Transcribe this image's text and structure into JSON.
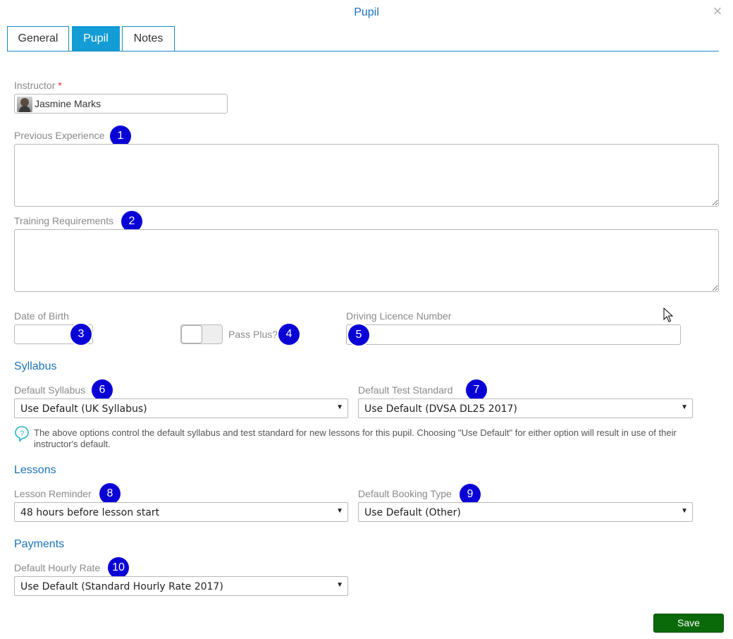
{
  "dialog": {
    "title": "Pupil",
    "close_icon": "×"
  },
  "tabs": [
    {
      "label": "General",
      "active": false
    },
    {
      "label": "Pupil",
      "active": true
    },
    {
      "label": "Notes",
      "active": false
    }
  ],
  "form": {
    "instructor": {
      "label": "Instructor",
      "required_mark": "*",
      "value": "Jasmine Marks"
    },
    "previous_experience": {
      "label": "Previous Experience",
      "value": ""
    },
    "training_requirements": {
      "label": "Training Requirements",
      "value": ""
    },
    "date_of_birth": {
      "label": "Date of Birth",
      "value": ""
    },
    "pass_plus": {
      "label": "Pass Plus?",
      "checked": false
    },
    "driving_licence": {
      "label": "Driving Licence Number",
      "value": ""
    }
  },
  "sections": {
    "syllabus": "Syllabus",
    "lessons": "Lessons",
    "payments": "Payments"
  },
  "syllabus": {
    "default_syllabus": {
      "label": "Default Syllabus",
      "value": "Use Default (UK Syllabus)"
    },
    "default_test_standard": {
      "label": "Default Test Standard",
      "value": "Use Default (DVSA DL25 2017)"
    },
    "help_text": "The above options control the default syllabus and test standard for new lessons for this pupil. Choosing \"Use Default\" for either option will result in use of their instructor's default."
  },
  "lessons": {
    "lesson_reminder": {
      "label": "Lesson Reminder",
      "value": "48 hours before lesson start"
    },
    "default_booking_type": {
      "label": "Default Booking Type",
      "value": "Use Default (Other)"
    }
  },
  "payments": {
    "default_hourly_rate": {
      "label": "Default Hourly Rate",
      "value": "Use Default (Standard Hourly Rate 2017)"
    }
  },
  "badges": [
    "1",
    "2",
    "3",
    "4",
    "5",
    "6",
    "7",
    "8",
    "9",
    "10"
  ],
  "save_label": "Save",
  "colors": {
    "accent": "#149cd6",
    "section": "#1a73b8",
    "badge": "#0a00d6",
    "save": "#0a6a0a"
  }
}
